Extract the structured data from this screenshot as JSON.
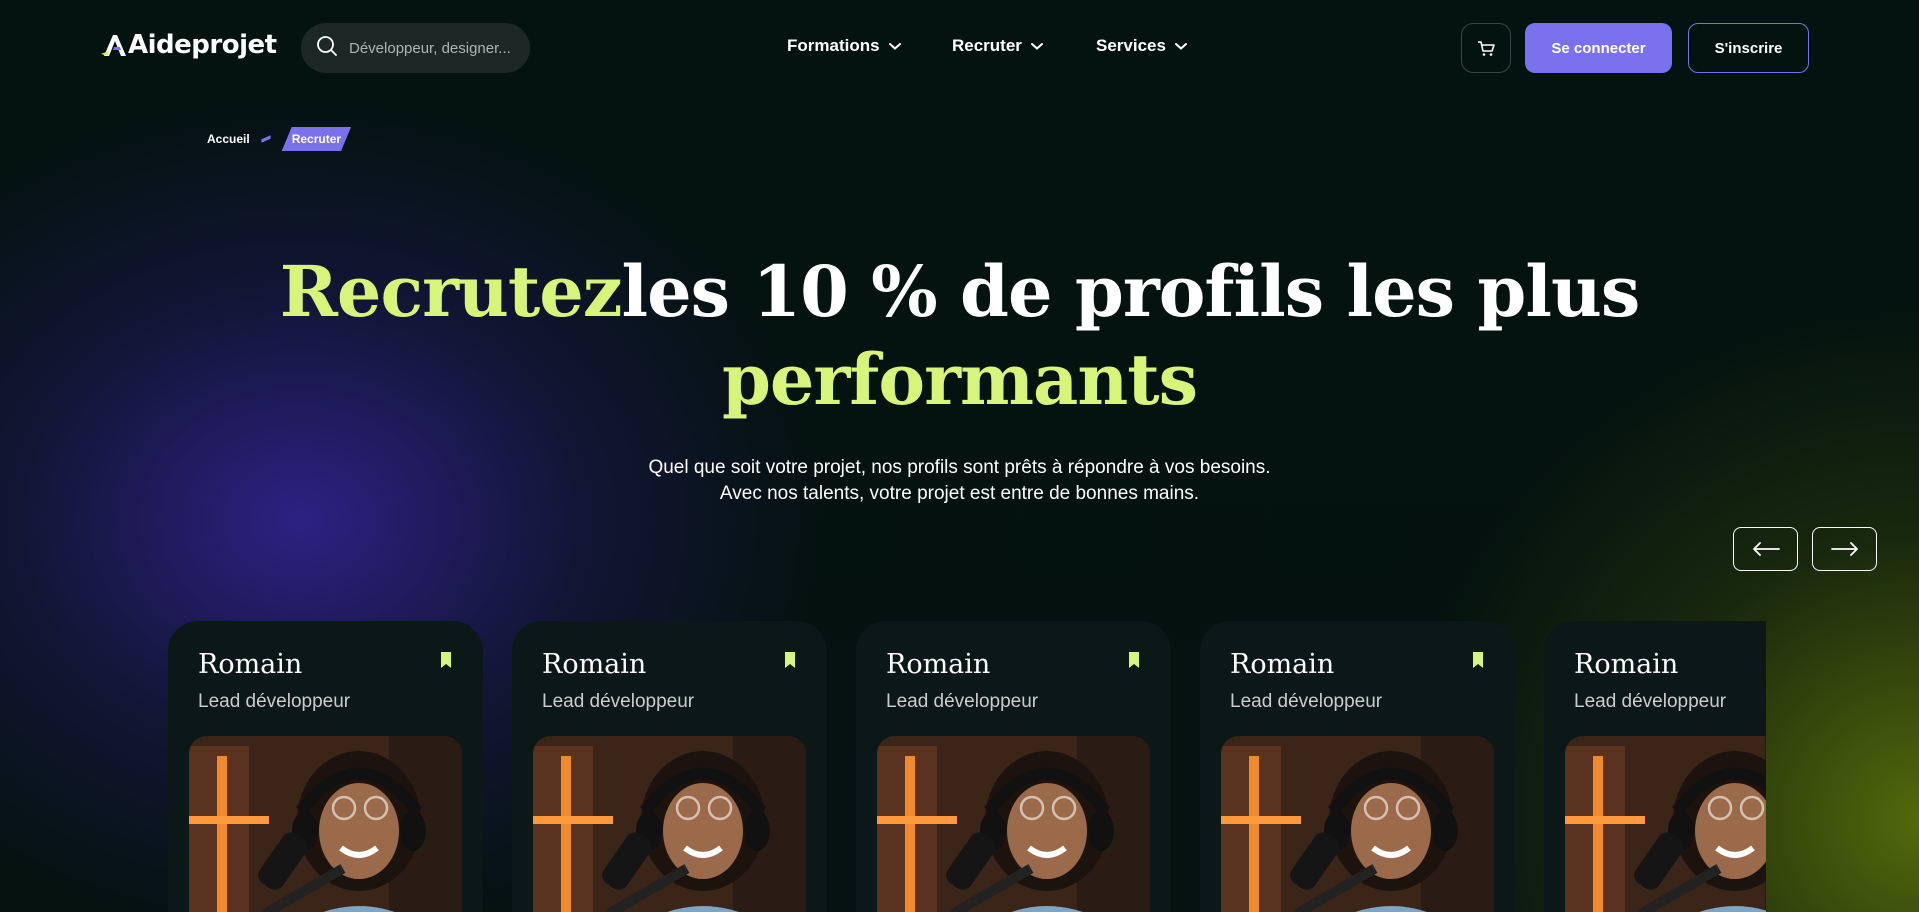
{
  "header": {
    "logo_text": "Aideprojet",
    "search_placeholder": "Développeur, designer...",
    "nav": [
      {
        "label": "Formations"
      },
      {
        "label": "Recruter"
      },
      {
        "label": "Services"
      }
    ],
    "login_label": "Se connecter",
    "signup_label": "S'inscrire"
  },
  "breadcrumb": {
    "home": "Accueil",
    "current": "Recruter"
  },
  "hero": {
    "title_accent_1": "Recrutez",
    "title_main": "les 10 % de profils les plus",
    "title_accent_2": "performants",
    "subtitle_line_1": "Quel que soit votre projet, nos profils sont prêts à répondre à vos besoins.",
    "subtitle_line_2": "Avec nos talents, votre projet est entre de bonnes mains."
  },
  "colors": {
    "accent_green": "#d7f57a",
    "accent_purple": "#7b70ee",
    "card_bg": "#0b1817"
  },
  "cards": [
    {
      "name": "Romain",
      "role": "Lead développeur"
    },
    {
      "name": "Romain",
      "role": "Lead développeur"
    },
    {
      "name": "Romain",
      "role": "Lead développeur"
    },
    {
      "name": "Romain",
      "role": "Lead développeur"
    },
    {
      "name": "Romain",
      "role": "Lead développeur"
    }
  ],
  "icons": {
    "search": "search-icon",
    "chevron": "chevron-down-icon",
    "cart": "cart-icon",
    "prev": "arrow-left-icon",
    "next": "arrow-right-icon",
    "bookmark": "bookmark-icon"
  }
}
